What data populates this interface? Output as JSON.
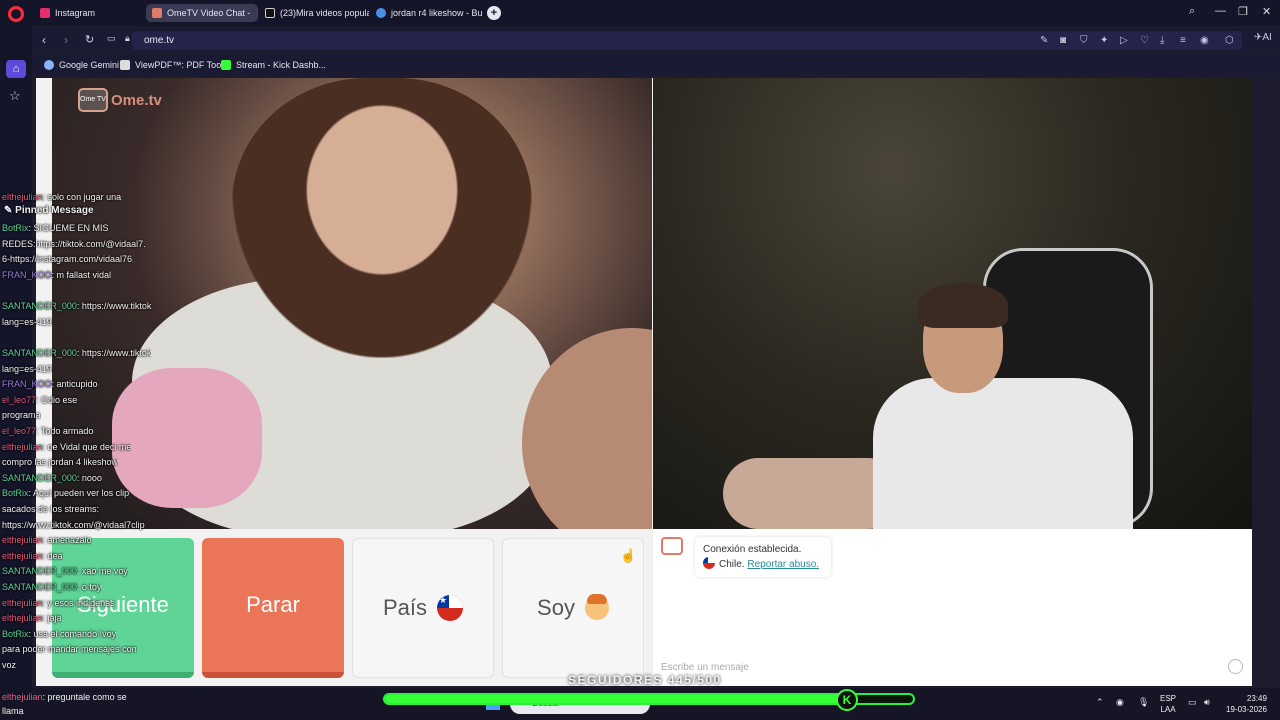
{
  "browser": {
    "tabs": [
      {
        "label": "Instagram",
        "color": "#e1306c"
      },
      {
        "label": "OmeTV Video Chat -",
        "color": "#e07b6a"
      },
      {
        "label": "(23)Mira videos populares",
        "color": "#111111"
      },
      {
        "label": "jordan r4 likeshow - Busca",
        "color": "#4a90e2"
      }
    ],
    "url": "ome.tv",
    "bookmarks": [
      {
        "label": "Google Gemini"
      },
      {
        "label": "ViewPDF™: PDF Too..."
      },
      {
        "label": "Stream - Kick Dashb..."
      }
    ],
    "ai_label": "AI"
  },
  "site": {
    "logo_text": "Ome.tv",
    "logo_badge": "Ome TV",
    "buttons": {
      "next": "Siguiente",
      "stop": "Parar",
      "country": "País",
      "me": "Soy"
    },
    "chat": {
      "status": "Conexión establecida.",
      "country": "Chile.",
      "report": "Reportar abuso.",
      "placeholder": "Escribe un mensaje"
    }
  },
  "overlay": {
    "pinned_title": "Pinned Message",
    "lines": [
      {
        "user": "elthejulian",
        "text": "solo con jugar una",
        "ucolor": "u-red"
      },
      {
        "user": "",
        "text": "",
        "ucolor": ""
      },
      {
        "user": "BotRix",
        "text": "SIGUEME EN MIS",
        "ucolor": "u-green"
      },
      {
        "user": "",
        "text": "REDES:https://tiktok.com/@vidaal7.",
        "ucolor": ""
      },
      {
        "user": "",
        "text": "6-https://instagram.com/vidaal76",
        "ucolor": ""
      },
      {
        "user": "FRAN_KOO",
        "text": "m fallast vidal",
        "ucolor": "u-purple"
      },
      {
        "user": "",
        "text": "",
        "ucolor": ""
      },
      {
        "user": "SANTANDER_000",
        "text": "https://www.tiktok",
        "ucolor": "u-green"
      },
      {
        "user": "",
        "text": "lang=es-419",
        "ucolor": ""
      },
      {
        "user": "",
        "text": "",
        "ucolor": ""
      },
      {
        "user": "SANTANDER_000",
        "text": "https://www.tiktok",
        "ucolor": "u-green"
      },
      {
        "user": "",
        "text": "lang=es-419",
        "ucolor": ""
      },
      {
        "user": "FRAN_KOO",
        "text": "anticupido",
        "ucolor": "u-purple"
      },
      {
        "user": "el_leo77",
        "text": "Odio ese",
        "ucolor": "u-red"
      },
      {
        "user": "",
        "text": "programa",
        "ucolor": ""
      },
      {
        "user": "el_leo77",
        "text": "Todo armado",
        "ucolor": "u-red"
      },
      {
        "user": "elthejulian",
        "text": "oe Vidal que deci me",
        "ucolor": "u-red"
      },
      {
        "user": "",
        "text": "compro las jordan 4 likeshow",
        "ucolor": ""
      },
      {
        "user": "SANTANDER_000",
        "text": "nooo",
        "ucolor": "u-green"
      },
      {
        "user": "BotRix",
        "text": "Aquí pueden ver los clip",
        "ucolor": "u-green"
      },
      {
        "user": "",
        "text": "sacados de los streams:",
        "ucolor": ""
      },
      {
        "user": "",
        "text": "https://www.tiktok.com/@vidaal7clip",
        "ucolor": ""
      },
      {
        "user": "elthejulian",
        "text": "amenazalo",
        "ucolor": "u-red"
      },
      {
        "user": "elthejulian",
        "text": "dea",
        "ucolor": "u-red"
      },
      {
        "user": "SANTANDER_000",
        "text": "xao me voy",
        "ucolor": "u-green"
      },
      {
        "user": "SANTANDER_000",
        "text": "o toy",
        "ucolor": "u-green"
      },
      {
        "user": "elthejulian",
        "text": "y esos indigenas",
        "ucolor": "u-red"
      },
      {
        "user": "elthejulian",
        "text": "jaja",
        "ucolor": "u-red"
      },
      {
        "user": "BotRix",
        "text": "usa el comando !voy",
        "ucolor": "u-green"
      },
      {
        "user": "",
        "text": "para poder mandar mensajes con",
        "ucolor": ""
      },
      {
        "user": "",
        "text": "voz",
        "ucolor": ""
      }
    ],
    "last_user": "elthejulian",
    "last_text": "preguntale como se",
    "last_text2": "llama",
    "followers_label": "SEGUIDORES 445/500",
    "followers_progress": 0.89,
    "badge": "K"
  },
  "taskbar": {
    "search_placeholder": "Buscar",
    "lang": "ESP",
    "lang2": "LAA",
    "time": "23:49",
    "date": "19-03-2026"
  },
  "colors": {
    "next": "#5fd497",
    "stop": "#ea7559",
    "progress": "#36ff38"
  }
}
